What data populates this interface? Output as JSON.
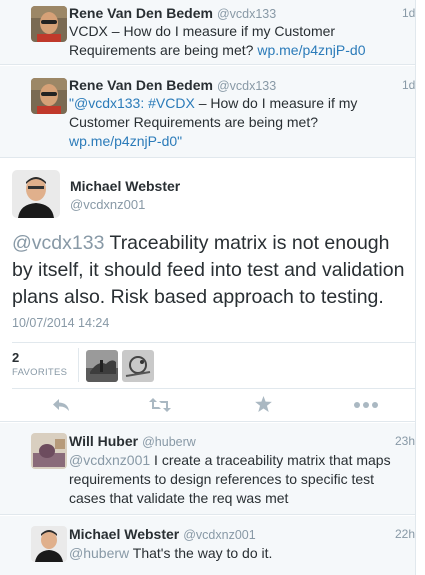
{
  "tweets_above": [
    {
      "name": "Rene Van Den Bedem",
      "handle": "@vcdx133",
      "time": "1d",
      "text_plain": "VCDX – How do I measure if my Customer Requirements are being met? ",
      "link": "wp.me/p4znjP-d0"
    },
    {
      "name": "Rene Van Den Bedem",
      "handle": "@vcdx133",
      "time": "1d",
      "quote_open": "\"",
      "mention": "@vcdx133",
      "text_plain": ": ",
      "hashtag": "#VCDX",
      "text_rest": " – How do I measure if my Customer Requirements are being met? ",
      "link": "wp.me/p4znjP-d0",
      "quote_close": "\""
    }
  ],
  "main_tweet": {
    "name": "Michael Webster",
    "handle": "@vcdxnz001",
    "mention": "@vcdx133",
    "text": " Traceability matrix is not enough by itself, it should feed into test and validation plans also. Risk based approach to testing.",
    "timestamp": "10/07/2014 14:24",
    "favorites_count": "2",
    "favorites_label": "FAVORITES"
  },
  "replies": [
    {
      "name": "Will Huber",
      "handle": "@huberw",
      "time": "23h",
      "mention": "@vcdxnz001",
      "text": " I create a traceability matrix that maps requirements to design references to specific test cases that validate the req was met"
    },
    {
      "name": "Michael Webster",
      "handle": "@vcdxnz001",
      "time": "22h",
      "mention": "@huberw",
      "text": " That's the way to do it."
    }
  ],
  "icons": [
    "reply-icon",
    "retweet-icon",
    "favorite-star-icon",
    "more-icon"
  ],
  "colors": {
    "link": "#2b7bb9",
    "muted": "#8899a6",
    "text": "#292f33",
    "context_bg": "#f5f8fa"
  }
}
